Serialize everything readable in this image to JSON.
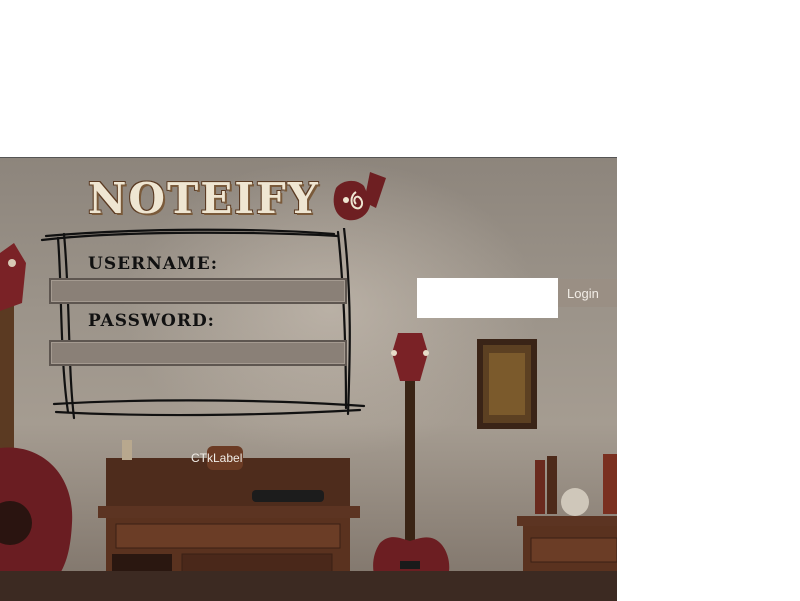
{
  "app": {
    "title": "NOTEIFY"
  },
  "form": {
    "username_label": "USERNAME:",
    "username_value": "",
    "password_label": "PASSWORD:",
    "password_value": "",
    "side_input_value": "",
    "login_label": "Login",
    "status_label": "CTkLabel"
  },
  "icons": {
    "logo": "music-note-logo-icon"
  },
  "colors": {
    "title_text": "#efe6d2",
    "field_bg": "#8a8077",
    "button_bg": "#9a8f84",
    "logo_red": "#6e1f22"
  }
}
